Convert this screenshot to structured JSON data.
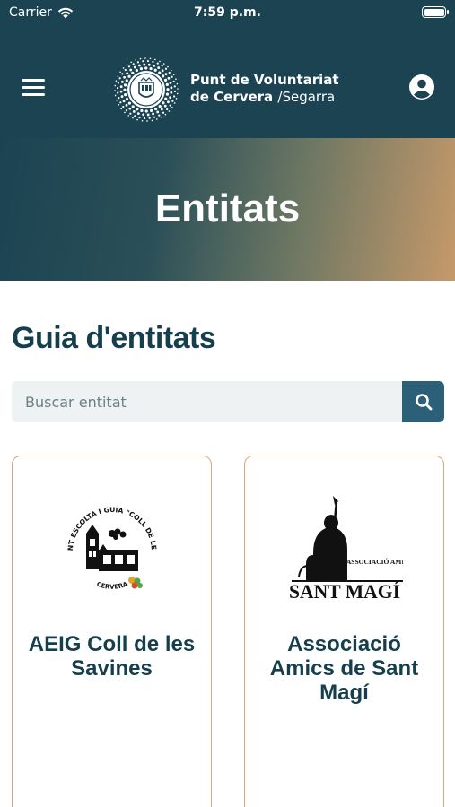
{
  "status_bar": {
    "carrier": "Carrier",
    "time": "7:59 p.m."
  },
  "header": {
    "brand_line1": "Punt de Voluntariat",
    "brand_line2_bold": "de Cervera ",
    "brand_line2_light": "/Segarra",
    "menu_icon": "hamburger-icon",
    "user_icon": "user-circle-icon"
  },
  "hero": {
    "title": "Entitats"
  },
  "main": {
    "section_title": "Guia d'entitats",
    "search": {
      "placeholder": "Buscar entitat",
      "value": "",
      "button_icon": "search-icon"
    },
    "entities": [
      {
        "name": "AEIG Coll de les Savines",
        "logo_text_top": "AGRUPAMENT ESCOLTA I GUIA \"COLL DE LES SAVINES\"",
        "logo_text_bottom": "CERVERA"
      },
      {
        "name": "Associació Amics de Sant Magí",
        "logo_text_small": "ASSOCIACIÓ AMICS DE",
        "logo_text_big": "SANT MAGÍ"
      }
    ]
  },
  "colors": {
    "header_bg": "#1c4352",
    "accent": "#2b6078",
    "card_border": "#d9a57a",
    "text": "#163f4d"
  }
}
